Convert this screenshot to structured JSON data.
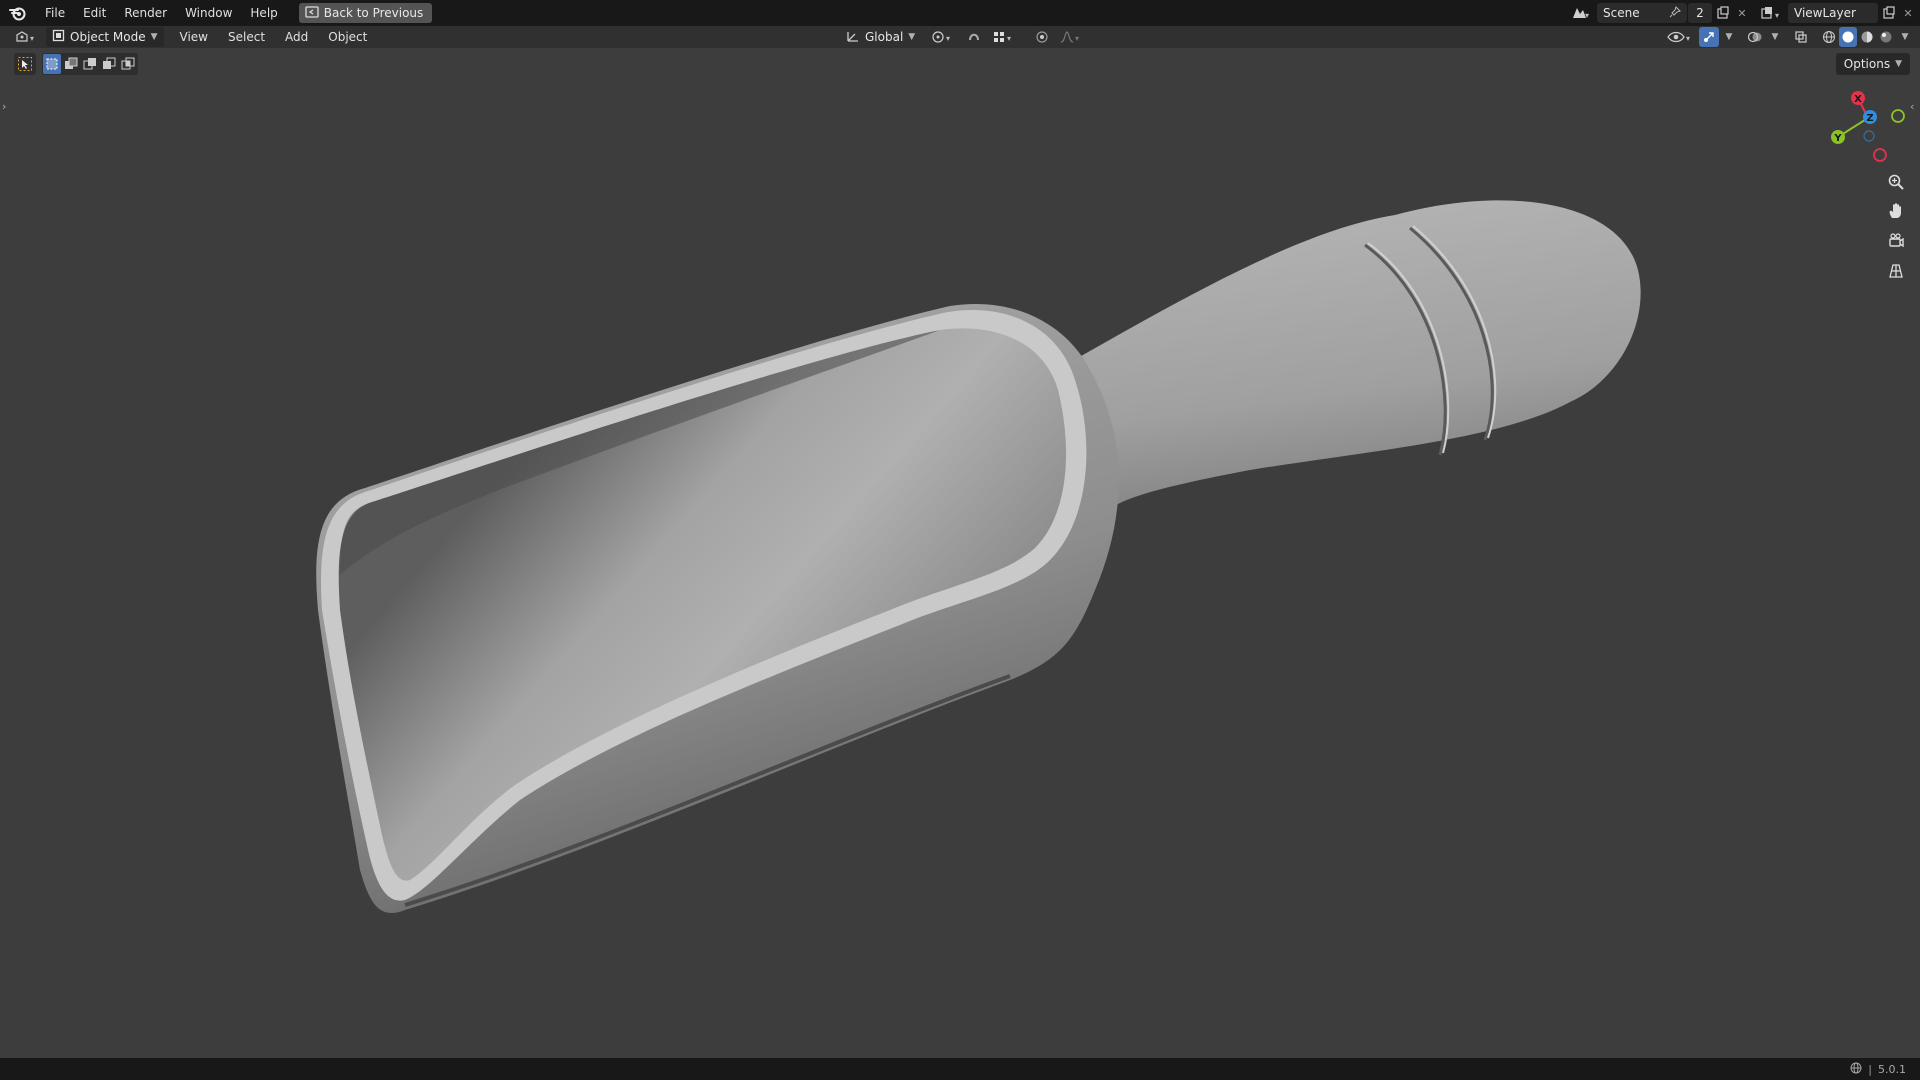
{
  "app": {
    "name": "Blender",
    "version": "5.0.1"
  },
  "topbar": {
    "menus": [
      "File",
      "Edit",
      "Render",
      "Window",
      "Help"
    ],
    "back_button": "Back to Previous",
    "scene": {
      "value": "Scene",
      "users": "2"
    },
    "view_layer": {
      "value": "ViewLayer"
    }
  },
  "header": {
    "mode": "Object Mode",
    "menus": [
      "View",
      "Select",
      "Add",
      "Object"
    ],
    "transform_orientation": "Global",
    "shading": {
      "active": "solid"
    }
  },
  "viewport": {
    "options_label": "Options",
    "gizmo": {
      "x_label": "X",
      "y_label": "Y",
      "z_label": "Z"
    },
    "object": "scoop",
    "colors": {
      "background": "#3d3d3d",
      "mesh": "#9a9a9a",
      "x_axis": "#e3334e",
      "y_axis": "#8bc226",
      "z_axis": "#2e8fe0"
    }
  },
  "status": {
    "version": "5.0.1"
  }
}
